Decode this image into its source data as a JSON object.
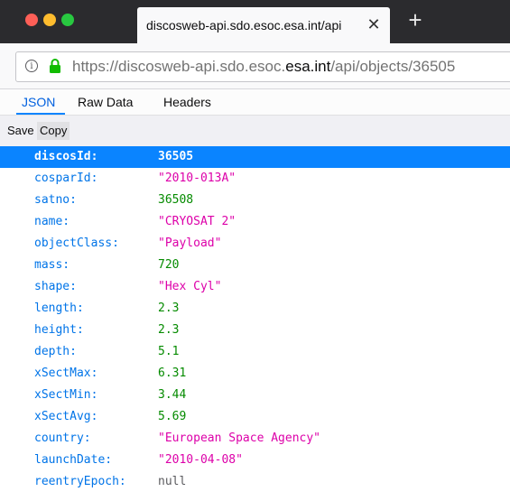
{
  "browser": {
    "tab_title": "discosweb-api.sdo.esoc.esa.int/api",
    "tab_close": "✕",
    "new_tab": "+",
    "url_prefix": "https://discosweb-api.sdo.esoc.",
    "url_host": "esa.int",
    "url_path": "/api/objects/36505"
  },
  "viewer": {
    "tabs": [
      "JSON",
      "Raw Data",
      "Headers"
    ],
    "active_tab": "JSON",
    "save_label": "Save",
    "copy_label": "Copy"
  },
  "colors": {
    "selected_row": "#0a84ff",
    "key": "#0074e8",
    "number": "#058b00",
    "string": "#dd00a9",
    "lock": "#12bc00"
  },
  "json_rows": [
    {
      "key": "discosId:",
      "value": "36505",
      "type": "num",
      "selected": true
    },
    {
      "key": "cosparId:",
      "value": "\"2010-013A\"",
      "type": "str"
    },
    {
      "key": "satno:",
      "value": "36508",
      "type": "num"
    },
    {
      "key": "name:",
      "value": "\"CRYOSAT 2\"",
      "type": "str"
    },
    {
      "key": "objectClass:",
      "value": "\"Payload\"",
      "type": "str"
    },
    {
      "key": "mass:",
      "value": "720",
      "type": "num"
    },
    {
      "key": "shape:",
      "value": "\"Hex Cyl\"",
      "type": "str"
    },
    {
      "key": "length:",
      "value": "2.3",
      "type": "num"
    },
    {
      "key": "height:",
      "value": "2.3",
      "type": "num"
    },
    {
      "key": "depth:",
      "value": "5.1",
      "type": "num"
    },
    {
      "key": "xSectMax:",
      "value": "6.31",
      "type": "num"
    },
    {
      "key": "xSectMin:",
      "value": "3.44",
      "type": "num"
    },
    {
      "key": "xSectAvg:",
      "value": "5.69",
      "type": "num"
    },
    {
      "key": "country:",
      "value": "\"European Space Agency\"",
      "type": "str"
    },
    {
      "key": "launchDate:",
      "value": "\"2010-04-08\"",
      "type": "str"
    },
    {
      "key": "reentryEpoch:",
      "value": "null",
      "type": "null"
    }
  ]
}
